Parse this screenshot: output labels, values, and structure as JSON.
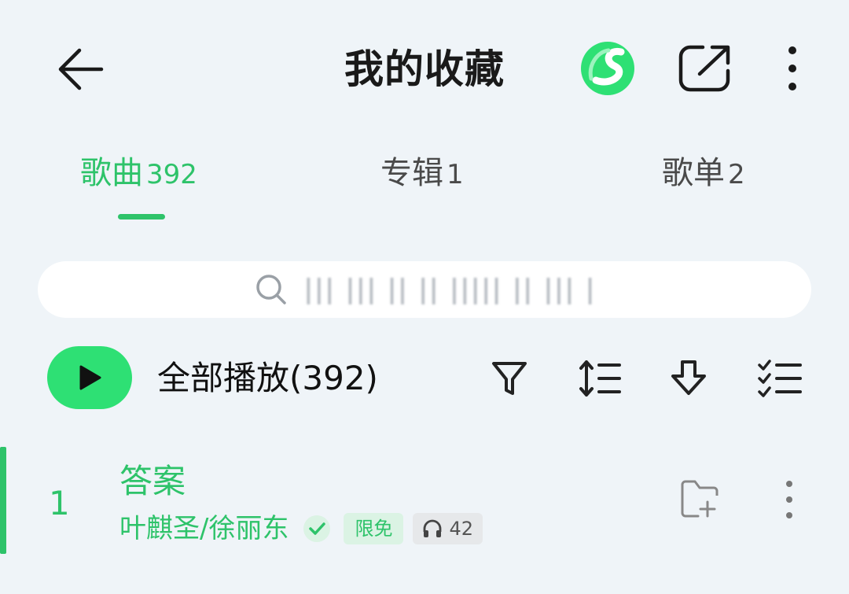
{
  "header": {
    "title": "我的收藏"
  },
  "tabs": [
    {
      "label": "歌曲",
      "count": "392",
      "active": true
    },
    {
      "label": "专辑",
      "count": "1",
      "active": false
    },
    {
      "label": "歌单",
      "count": "2",
      "active": false
    }
  ],
  "search": {
    "placeholder": "||| ||| || || ||||| || ||| |"
  },
  "play_all": {
    "label": "全部播放(392)"
  },
  "songs": [
    {
      "index": "1",
      "title": "答案",
      "artist": "叶麒圣/徐丽东",
      "badge": "限免",
      "listen_count": "42"
    }
  ],
  "colors": {
    "accent": "#2ec36a",
    "play_button": "#2ee074",
    "background": "#eff4f8"
  },
  "icons": [
    "back-arrow-icon",
    "app-logo-icon",
    "share-icon",
    "more-vertical-icon",
    "search-icon",
    "play-icon",
    "filter-icon",
    "sort-icon",
    "download-icon",
    "multiselect-icon",
    "verified-icon",
    "headphones-icon",
    "add-to-playlist-icon"
  ]
}
